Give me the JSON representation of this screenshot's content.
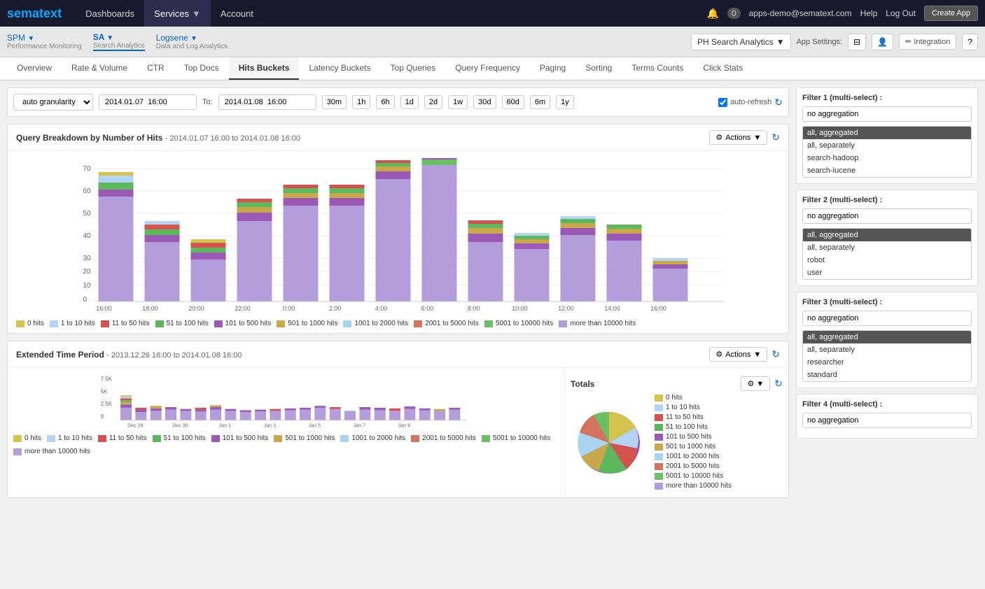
{
  "topNav": {
    "logo": "sema",
    "logoAccent": "text",
    "navItems": [
      "Dashboards",
      "Services",
      "Account"
    ],
    "activeNav": "Services",
    "userEmail": "apps-demo@sematext.com",
    "helpLabel": "Help",
    "logoutLabel": "Log Out",
    "createAppLabel": "Create App",
    "notificationCount": "0"
  },
  "subNav": {
    "spmLabel": "SPM",
    "spmSub": "Performance Monitoring",
    "saLabel": "SA",
    "saSub": "Search Analytics",
    "logseneLabel": "Logsene",
    "logseneSub": "Data and Log Analytics",
    "appSelectorLabel": "PH Search Analytics",
    "appSettingsLabel": "App Settings:",
    "integrationLabel": "Integration",
    "helpIcon": "?"
  },
  "tabs": {
    "items": [
      "Overview",
      "Rate & Volume",
      "CTR",
      "Top Docs",
      "Hits Buckets",
      "Latency Buckets",
      "Top Queries",
      "Query Frequency",
      "Paging",
      "Sorting",
      "Terms Counts",
      "Click Stats"
    ],
    "active": "Hits Buckets"
  },
  "controls": {
    "granularityLabel": "auto granularity",
    "fromDate": "2014.01.07  16:00",
    "toLabel": "To:",
    "toDate": "2014.01.08  16:00",
    "timeButtons": [
      "30m",
      "1h",
      "6h",
      "1d",
      "2d",
      "1w",
      "30d",
      "60d",
      "6m",
      "1y"
    ],
    "autoRefreshLabel": "auto-refresh"
  },
  "mainChart": {
    "title": "Query Breakdown by Number of Hits",
    "dateRange": "- 2014.01.07 16:00 to 2014.01.08 16:00",
    "actionsLabel": "Actions",
    "yMax": 70,
    "xLabels": [
      "16:00",
      "18:00",
      "20:00",
      "22:00",
      "0:00",
      "2:00",
      "4:00",
      "6:00",
      "8:00",
      "10:00",
      "12:00",
      "14:00",
      "16:00"
    ],
    "legend": [
      {
        "label": "0 hits",
        "color": "#d4c44e"
      },
      {
        "label": "1 to 10 hits",
        "color": "#b3d4f5"
      },
      {
        "label": "11 to 50 hits",
        "color": "#d4534e"
      },
      {
        "label": "51 to 100 hits",
        "color": "#5cb85c"
      },
      {
        "label": "101 to 500 hits",
        "color": "#9b59b6"
      },
      {
        "label": "501 to 1000 hits",
        "color": "#c8a84b"
      },
      {
        "label": "1001 to 2000 hits",
        "color": "#a8d4f0"
      },
      {
        "label": "2001 to 5000 hits",
        "color": "#d4735e"
      },
      {
        "label": "5001 to 10000 hits",
        "color": "#6dbf67"
      },
      {
        "label": "more than 10000 hits",
        "color": "#b39ddb"
      }
    ]
  },
  "extendedChart": {
    "title": "Extended Time Period",
    "dateRange": "- 2013.12.26 16:00 to 2014.01.08 16:00",
    "actionsLabel": "Actions",
    "xLabels": [
      "Dec 28",
      "Dec 30",
      "Jan 1",
      "Jan 3",
      "Jan 5",
      "Jan 7",
      "Jan 9"
    ],
    "yLabels": [
      "7.5K",
      "5K",
      "2.5K",
      "0"
    ],
    "legend": [
      {
        "label": "0 hits",
        "color": "#d4c44e"
      },
      {
        "label": "1 to 10 hits",
        "color": "#b3d4f5"
      },
      {
        "label": "11 to 50 hits",
        "color": "#d4534e"
      },
      {
        "label": "51 to 100 hits",
        "color": "#5cb85c"
      },
      {
        "label": "101 to 500 hits",
        "color": "#9b59b6"
      },
      {
        "label": "501 to 1000 hits",
        "color": "#c8a84b"
      },
      {
        "label": "1001 to 2000 hits",
        "color": "#a8d4f0"
      },
      {
        "label": "2001 to 5000 hits",
        "color": "#d4735e"
      },
      {
        "label": "5001 to 10000 hits",
        "color": "#6dbf67"
      },
      {
        "label": "more than 10000 hits",
        "color": "#b39ddb"
      }
    ]
  },
  "totals": {
    "title": "Totals",
    "legend": [
      {
        "label": "0 hits",
        "color": "#d4c44e"
      },
      {
        "label": "1 to 10 hits",
        "color": "#b3d4f5"
      },
      {
        "label": "11 to 50 hits",
        "color": "#d4534e"
      },
      {
        "label": "51 to 100 hits",
        "color": "#5cb85c"
      },
      {
        "label": "101 to 500 hits",
        "color": "#9b59b6"
      },
      {
        "label": "501 to 1000 hits",
        "color": "#c8a84b"
      },
      {
        "label": "1001 to 2000 hits",
        "color": "#a8d4f0"
      },
      {
        "label": "2001 to 5000 hits",
        "color": "#d4735e"
      },
      {
        "label": "5001 to 10000 hits",
        "color": "#6dbf67"
      },
      {
        "label": "more than 10000 hits",
        "color": "#b39ddb"
      }
    ]
  },
  "filters": [
    {
      "title": "Filter 1 (multi-select) :",
      "selectValue": "no aggregation",
      "items": [
        "all, aggregated",
        "all, separately",
        "search-hadoop",
        "search-lucene"
      ],
      "selected": "all, aggregated"
    },
    {
      "title": "Filter 2 (multi-select) :",
      "selectValue": "no aggregation",
      "items": [
        "all, aggregated",
        "all, separately",
        "robot",
        "user"
      ],
      "selected": "all, aggregated"
    },
    {
      "title": "Filter 3 (multi-select) :",
      "selectValue": "no aggregation",
      "items": [
        "all, aggregated",
        "all, separately",
        "researcher",
        "standard"
      ],
      "selected": "all, aggregated"
    },
    {
      "title": "Filter 4 (multi-select) :",
      "selectValue": "no aggregation",
      "items": [],
      "selected": ""
    }
  ]
}
